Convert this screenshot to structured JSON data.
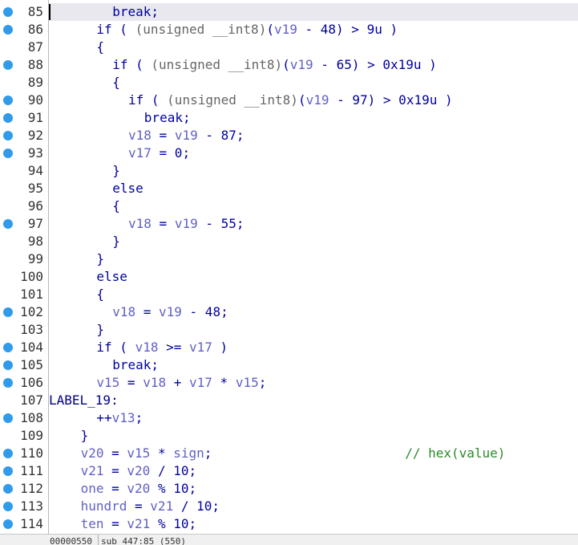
{
  "editor": {
    "current_line": 85,
    "lines": [
      {
        "n": "85",
        "bp": true,
        "indent": 4,
        "tokens": [
          {
            "t": "break;"
          }
        ]
      },
      {
        "n": "86",
        "bp": true,
        "indent": 3,
        "tokens": [
          {
            "t": "if ( "
          },
          {
            "t": "(unsigned __int8)",
            "c": "gray"
          },
          {
            "t": "("
          },
          {
            "t": "v19",
            "c": "var"
          },
          {
            "t": " - 48) > 9u )"
          }
        ]
      },
      {
        "n": "87",
        "bp": false,
        "indent": 3,
        "tokens": [
          {
            "t": "{"
          }
        ]
      },
      {
        "n": "88",
        "bp": true,
        "indent": 4,
        "tokens": [
          {
            "t": "if ( "
          },
          {
            "t": "(unsigned __int8)",
            "c": "gray"
          },
          {
            "t": "("
          },
          {
            "t": "v19",
            "c": "var"
          },
          {
            "t": " - 65) > 0x19u )"
          }
        ]
      },
      {
        "n": "89",
        "bp": false,
        "indent": 4,
        "tokens": [
          {
            "t": "{"
          }
        ]
      },
      {
        "n": "90",
        "bp": true,
        "indent": 5,
        "tokens": [
          {
            "t": "if ( "
          },
          {
            "t": "(unsigned __int8)",
            "c": "gray"
          },
          {
            "t": "("
          },
          {
            "t": "v19",
            "c": "var"
          },
          {
            "t": " - 97) > 0x19u )"
          }
        ]
      },
      {
        "n": "91",
        "bp": true,
        "indent": 6,
        "tokens": [
          {
            "t": "break;"
          }
        ]
      },
      {
        "n": "92",
        "bp": true,
        "indent": 5,
        "tokens": [
          {
            "t": "v18",
            "c": "var"
          },
          {
            "t": " = "
          },
          {
            "t": "v19",
            "c": "var"
          },
          {
            "t": " - 87;"
          }
        ]
      },
      {
        "n": "93",
        "bp": true,
        "indent": 5,
        "tokens": [
          {
            "t": "v17",
            "c": "var"
          },
          {
            "t": " = 0;"
          }
        ]
      },
      {
        "n": "94",
        "bp": false,
        "indent": 4,
        "tokens": [
          {
            "t": "}"
          }
        ]
      },
      {
        "n": "95",
        "bp": false,
        "indent": 4,
        "tokens": [
          {
            "t": "else"
          }
        ]
      },
      {
        "n": "96",
        "bp": false,
        "indent": 4,
        "tokens": [
          {
            "t": "{"
          }
        ]
      },
      {
        "n": "97",
        "bp": true,
        "indent": 5,
        "tokens": [
          {
            "t": "v18",
            "c": "var"
          },
          {
            "t": " = "
          },
          {
            "t": "v19",
            "c": "var"
          },
          {
            "t": " - 55;"
          }
        ]
      },
      {
        "n": "98",
        "bp": false,
        "indent": 4,
        "tokens": [
          {
            "t": "}"
          }
        ]
      },
      {
        "n": "99",
        "bp": false,
        "indent": 3,
        "tokens": [
          {
            "t": "}"
          }
        ]
      },
      {
        "n": "100",
        "bp": false,
        "indent": 3,
        "tokens": [
          {
            "t": "else"
          }
        ]
      },
      {
        "n": "101",
        "bp": false,
        "indent": 3,
        "tokens": [
          {
            "t": "{"
          }
        ]
      },
      {
        "n": "102",
        "bp": true,
        "indent": 4,
        "tokens": [
          {
            "t": "v18",
            "c": "var"
          },
          {
            "t": " = "
          },
          {
            "t": "v19",
            "c": "var"
          },
          {
            "t": " - 48;"
          }
        ]
      },
      {
        "n": "103",
        "bp": false,
        "indent": 3,
        "tokens": [
          {
            "t": "}"
          }
        ]
      },
      {
        "n": "104",
        "bp": true,
        "indent": 3,
        "tokens": [
          {
            "t": "if ( "
          },
          {
            "t": "v18",
            "c": "var"
          },
          {
            "t": " >= "
          },
          {
            "t": "v17",
            "c": "var"
          },
          {
            "t": " )"
          }
        ]
      },
      {
        "n": "105",
        "bp": true,
        "indent": 4,
        "tokens": [
          {
            "t": "break;"
          }
        ]
      },
      {
        "n": "106",
        "bp": true,
        "indent": 3,
        "tokens": [
          {
            "t": "v15",
            "c": "var"
          },
          {
            "t": " = "
          },
          {
            "t": "v18",
            "c": "var"
          },
          {
            "t": " + "
          },
          {
            "t": "v17",
            "c": "var"
          },
          {
            "t": " * "
          },
          {
            "t": "v15",
            "c": "var"
          },
          {
            "t": ";"
          }
        ]
      },
      {
        "n": "107",
        "bp": false,
        "indent": 0,
        "tokens": [
          {
            "t": "LABEL_19:",
            "c": "label"
          }
        ]
      },
      {
        "n": "108",
        "bp": true,
        "indent": 3,
        "tokens": [
          {
            "t": "++"
          },
          {
            "t": "v13",
            "c": "var"
          },
          {
            "t": ";"
          }
        ]
      },
      {
        "n": "109",
        "bp": false,
        "indent": 2,
        "tokens": [
          {
            "t": "}"
          }
        ]
      },
      {
        "n": "110",
        "bp": true,
        "indent": 2,
        "tokens": [
          {
            "t": "v20",
            "c": "var"
          },
          {
            "t": " = "
          },
          {
            "t": "v15",
            "c": "var"
          },
          {
            "t": " * "
          },
          {
            "t": "sign",
            "c": "var"
          },
          {
            "t": ";                         "
          },
          {
            "t": "// hex(value)",
            "c": "comment"
          }
        ]
      },
      {
        "n": "111",
        "bp": true,
        "indent": 2,
        "tokens": [
          {
            "t": "v21",
            "c": "var"
          },
          {
            "t": " = "
          },
          {
            "t": "v20",
            "c": "var"
          },
          {
            "t": " / 10;"
          }
        ]
      },
      {
        "n": "112",
        "bp": true,
        "indent": 2,
        "tokens": [
          {
            "t": "one",
            "c": "var"
          },
          {
            "t": " = "
          },
          {
            "t": "v20",
            "c": "var"
          },
          {
            "t": " % 10;"
          }
        ]
      },
      {
        "n": "113",
        "bp": true,
        "indent": 2,
        "tokens": [
          {
            "t": "hundrd",
            "c": "var"
          },
          {
            "t": " = "
          },
          {
            "t": "v21",
            "c": "var"
          },
          {
            "t": " / 10;"
          }
        ]
      },
      {
        "n": "114",
        "bp": true,
        "indent": 2,
        "tokens": [
          {
            "t": "ten",
            "c": "var"
          },
          {
            "t": " = "
          },
          {
            "t": "v21",
            "c": "var"
          },
          {
            "t": " % 10;"
          }
        ]
      }
    ]
  },
  "status_bar": {
    "address": "00000550",
    "location": "sub_447:85 (550)"
  },
  "colors": {
    "keyword": "#0000a0",
    "variable": "#6060c8",
    "cast": "#666666",
    "comment": "#2a8a2a",
    "breakpoint": "#2f9bea",
    "current_line": "#e8e8ee"
  }
}
